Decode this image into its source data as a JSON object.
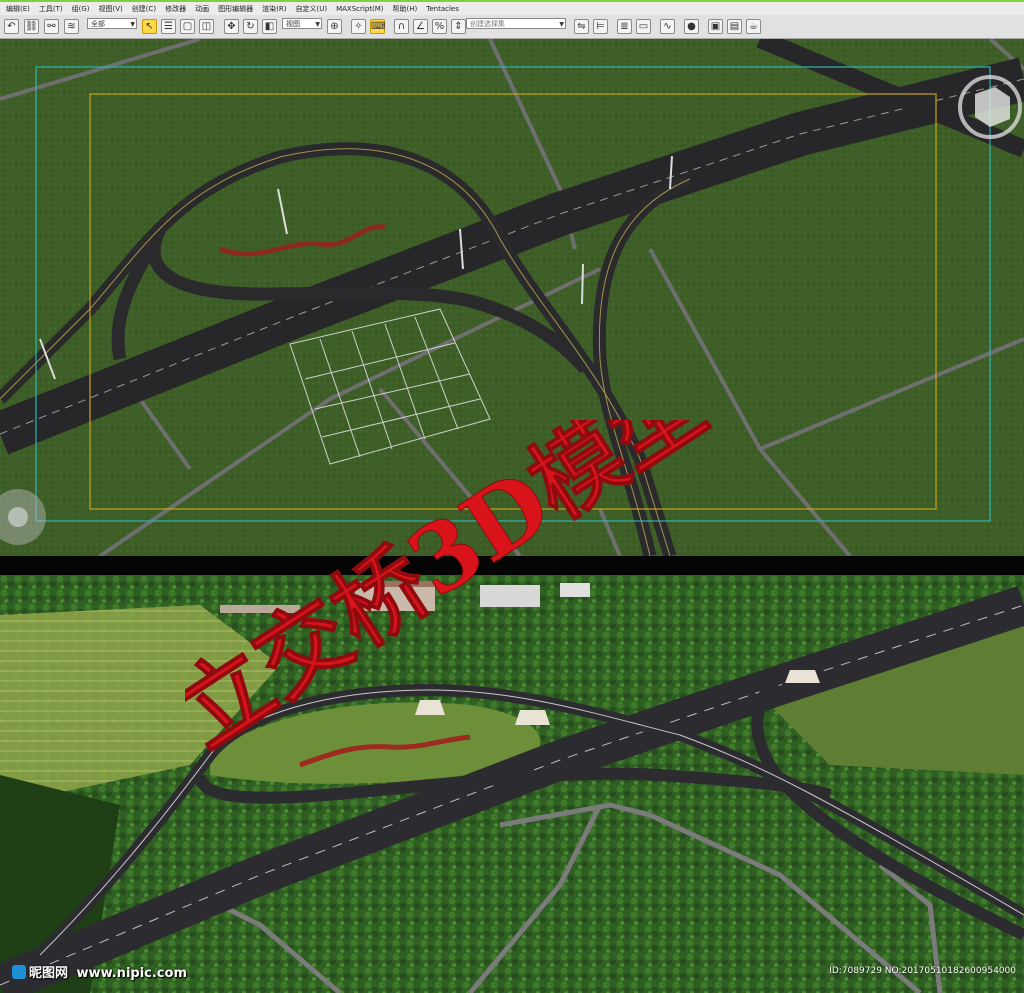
{
  "menu": [
    "编辑(E)",
    "工具(T)",
    "组(G)",
    "视图(V)",
    "创建(C)",
    "修改器",
    "动画",
    "图形编辑器",
    "渲染(R)",
    "自定义(U)",
    "MAXScript(M)",
    "帮助(H)",
    "Tentacles"
  ],
  "toolbar": {
    "selection_filter": "全部",
    "reference_coord": "视图",
    "named_selection_placeholder": "创建选择集"
  },
  "watermark_title": "立交桥3D模型",
  "footer": {
    "site_logo": "昵图网",
    "site_url": "www.nipic.com",
    "image_id": "ID:7089729 NO:20170510182600954000"
  },
  "colors": {
    "accent": "#7fd13b",
    "grass": "#3b5a26",
    "road": "#2b2b2e",
    "safe_frame_outer": "#2fb3b0",
    "safe_frame_inner": "#c7a21a",
    "watermark": "#d8141a"
  }
}
